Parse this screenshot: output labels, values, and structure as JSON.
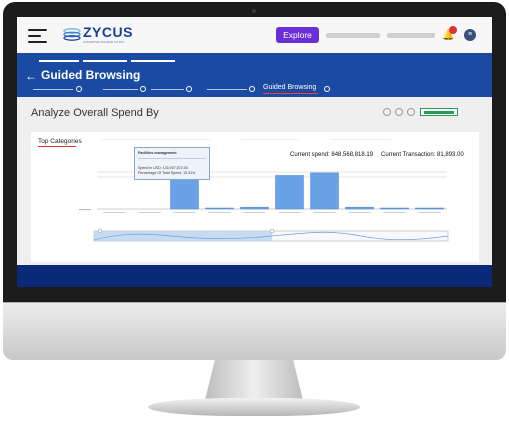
{
  "header": {
    "logo_text": "ZYCUS",
    "logo_tagline": "COGNITIVE SOURCE TO PAY",
    "explore_label": "Explore",
    "user_initial": "≡"
  },
  "nav": {
    "page_title": "Guided Browsing",
    "active_tab": "Guided Browsing"
  },
  "section": {
    "title": "Analyze Overall Spend By"
  },
  "card": {
    "tab_label": "Top Categories",
    "current_spend": "Current spend: 848,568,818.19",
    "current_transactions": "Current Transaction: 81,893.00"
  },
  "tooltip": {
    "heading": "Facilities management",
    "line1": "Spend in USD: 130,007,572.00",
    "line2": "Percentage Of Total Spend: 15.31%"
  },
  "colors": {
    "brand_blue": "#1b4aa3",
    "explore_purple": "#6a2fd9",
    "bar_blue": "#6aa2e8",
    "footer_navy": "#0a2a78"
  },
  "chart_data": {
    "type": "bar",
    "categories": [
      "",
      "",
      "",
      "",
      "",
      "",
      "",
      "",
      "",
      ""
    ],
    "values": [
      0,
      0,
      130,
      2,
      7,
      130,
      140,
      7,
      3,
      2
    ],
    "grid": true,
    "has_range_navigator": true
  }
}
